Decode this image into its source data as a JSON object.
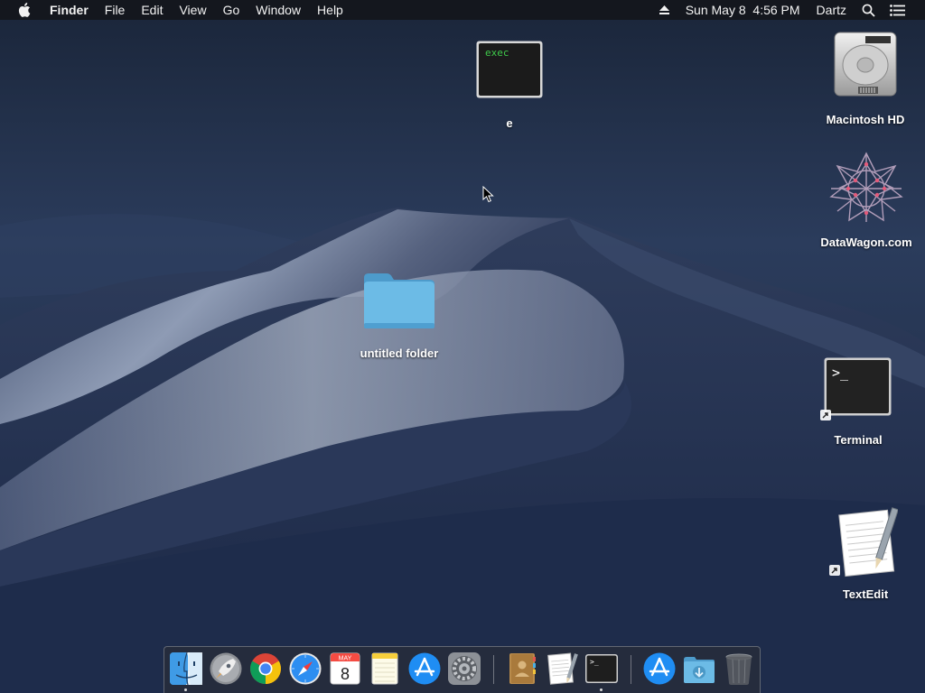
{
  "menubar": {
    "apple_icon": "apple-logo-icon",
    "app_name": "Finder",
    "menus": [
      "File",
      "Edit",
      "View",
      "Go",
      "Window",
      "Help"
    ],
    "eject_icon": "eject-icon",
    "datetime": "Sun May 8  4:56 PM",
    "user": "Dartz",
    "search_icon": "spotlight-search-icon",
    "notification_icon": "notification-center-icon"
  },
  "desktop": {
    "exec_file": {
      "label": "e",
      "thumbnail_text": "exec"
    },
    "folder": {
      "label": "untitled folder"
    },
    "drive": {
      "label": "Macintosh HD"
    },
    "datawagon": {
      "label": "DataWagon.com"
    },
    "terminal": {
      "label": "Terminal",
      "prompt": ">_"
    },
    "textedit": {
      "label": "TextEdit"
    }
  },
  "dock": {
    "calendar_month": "MAY",
    "calendar_day": "8",
    "items": [
      "finder-icon",
      "launchpad-icon",
      "chrome-icon",
      "safari-icon",
      "calendar-icon",
      "notes-icon",
      "app-store-icon",
      "system-preferences-icon",
      "contacts-icon",
      "textedit-icon",
      "terminal-icon",
      "app-store-downloads-icon",
      "downloads-folder-icon",
      "trash-icon"
    ]
  },
  "colors": {
    "menubar_bg": "#14161c",
    "folder_blue": "#5fb2e0",
    "terminal_green": "#3ec84a",
    "wallpaper_top": "#1b2740",
    "wallpaper_bottom": "#1c2a4a"
  }
}
